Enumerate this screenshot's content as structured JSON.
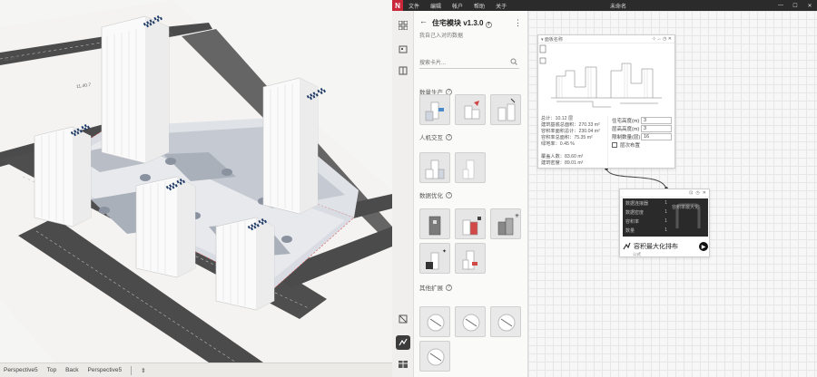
{
  "titlebar": {
    "logo": "N",
    "menus": [
      "文件",
      "编辑",
      "帐户",
      "帮助",
      "关于"
    ],
    "doc_title": "未命名",
    "min": "—",
    "max": "☐",
    "close": "✕"
  },
  "viewport": {
    "street_labels": [
      "12.35.7",
      "11.40.7"
    ],
    "status": {
      "view1": "Perspective5",
      "view2": "Top",
      "view3": "Back",
      "view4": "Perspective5",
      "more": "⇕"
    }
  },
  "plugin": {
    "back_icon": "←",
    "title": "住宅模块 v1.3.0",
    "help": "?",
    "more": "⋮",
    "subtitle": "我自己入对的数据",
    "search_placeholder": "搜索卡片...",
    "sections": [
      {
        "label": "数量生产"
      },
      {
        "label": "人机交互"
      },
      {
        "label": "数据优化"
      },
      {
        "label": "其他扩展"
      }
    ]
  },
  "node1": {
    "head": "▾ 面板名称",
    "tools": "⊹  ↔  ◷  ✕",
    "stats": [
      "总计：10.12 层",
      "建筑基底总面积：270.33 m²",
      "容积率面积总计：230.04 m²",
      "容积率总面积：75.35 m²",
      "绿地率：0.45 %",
      "",
      "覆盖人数：83.60 m²",
      "建筑密度：89.01 m²"
    ],
    "fields": [
      {
        "label": "住宅高度(m)",
        "value": "3"
      },
      {
        "label": "层高高度(m)",
        "value": "3"
      },
      {
        "label": "限制数量(层)",
        "value": "16"
      }
    ],
    "checkbox_label": "层次布置"
  },
  "node2": {
    "rows": [
      {
        "label": "数据连接器",
        "value": "1"
      },
      {
        "label": "数据密度",
        "value": "1"
      },
      {
        "label": "容积率",
        "value": "1"
      },
      {
        "label": "数量",
        "value": "1"
      }
    ],
    "preview_text": "容积率最大化",
    "footer": "容积最大化排布",
    "sub": "公式"
  },
  "colors": {
    "accent_red": "#c8283a",
    "dark": "#2b2b2b",
    "road": "#4a4a4a"
  }
}
